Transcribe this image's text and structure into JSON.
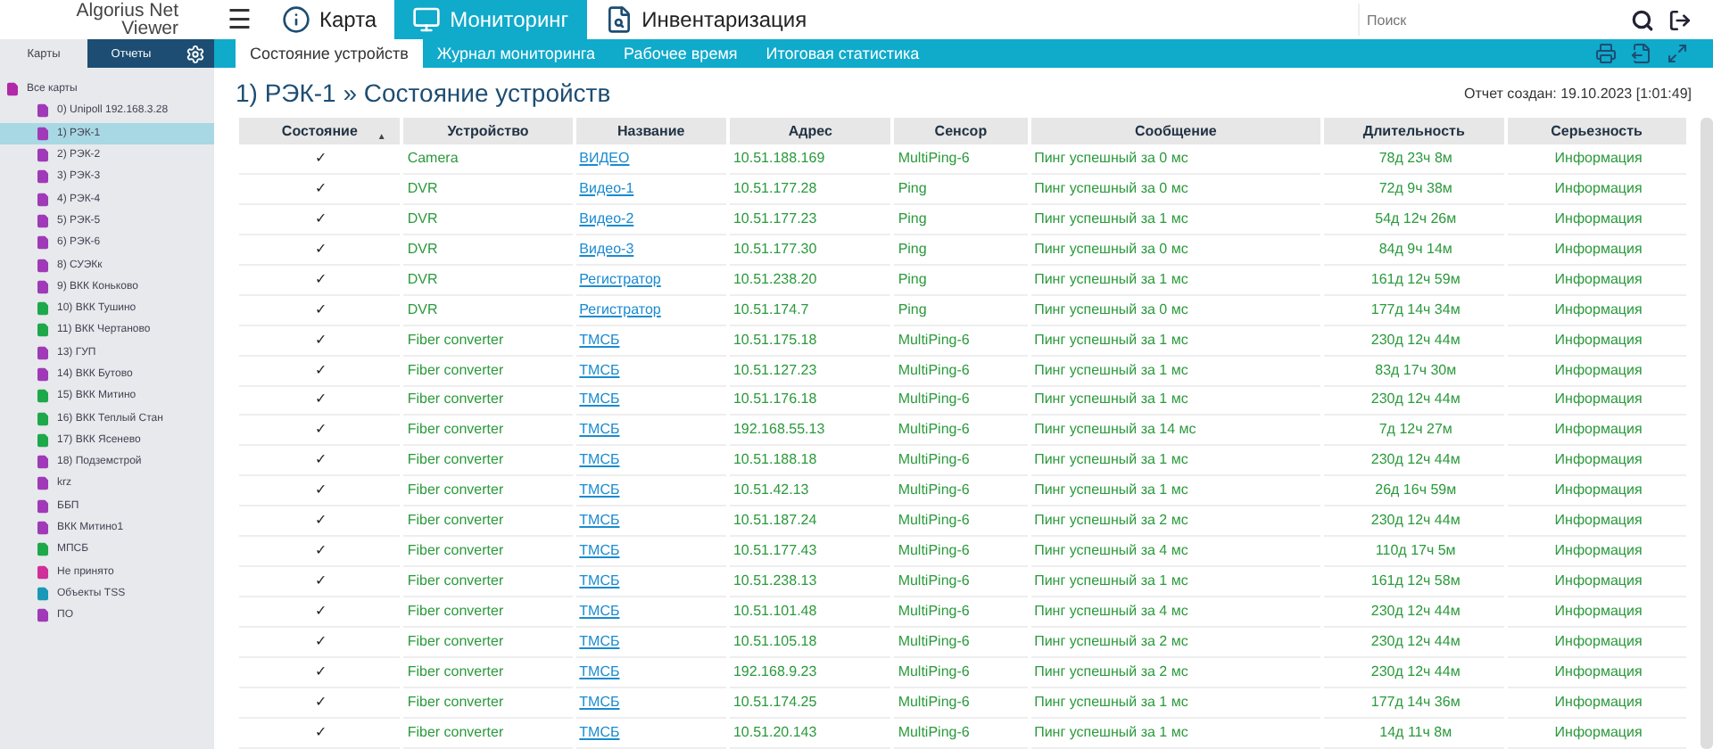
{
  "logo": {
    "line1": "Algorius Net",
    "line2": "Viewer"
  },
  "nav": {
    "menu_icon": "☰",
    "tabs": [
      {
        "label": "Карта",
        "selected": false
      },
      {
        "label": "Мониторинг",
        "selected": true
      },
      {
        "label": "Инвентаризация",
        "selected": false
      }
    ]
  },
  "search": {
    "placeholder": "Поиск"
  },
  "sidebar": {
    "tabs": [
      {
        "label": "Карты",
        "selected": true
      },
      {
        "label": "Отчеты",
        "selected": false
      }
    ],
    "root": {
      "label": "Все карты",
      "color": "#b02aa8",
      "children": [
        {
          "label": "0) Unipoll 192.168.3.28",
          "color": "#a03ab8",
          "selected": false
        },
        {
          "label": "1) РЭК-1",
          "color": "#a03ab8",
          "selected": true
        },
        {
          "label": "2) РЭК-2",
          "color": "#a03ab8",
          "selected": false
        },
        {
          "label": "3) РЭК-3",
          "color": "#a03ab8",
          "selected": false
        },
        {
          "label": "4) РЭК-4",
          "color": "#a03ab8",
          "selected": false
        },
        {
          "label": "5) РЭК-5",
          "color": "#a03ab8",
          "selected": false
        },
        {
          "label": "6) РЭК-6",
          "color": "#a03ab8",
          "selected": false
        },
        {
          "label": "8) СУЭКк",
          "color": "#a03ab8",
          "selected": false
        },
        {
          "label": "9) ВКК Коньково",
          "color": "#a03ab8",
          "selected": false
        },
        {
          "label": "10) ВКК Тушино",
          "color": "#1ea84a",
          "selected": false
        },
        {
          "label": "11) ВКК Чертаново",
          "color": "#1ea84a",
          "selected": false
        },
        {
          "label": "13) ГУП",
          "color": "#a03ab8",
          "selected": false
        },
        {
          "label": "14) ВКК Бутово",
          "color": "#a03ab8",
          "selected": false
        },
        {
          "label": "15) ВКК Митино",
          "color": "#1ea84a",
          "selected": false
        },
        {
          "label": "16) ВКК Теплый Стан",
          "color": "#1ea84a",
          "selected": false
        },
        {
          "label": "17) ВКК Ясенево",
          "color": "#1ea84a",
          "selected": false
        },
        {
          "label": "18) Подземстрой",
          "color": "#a03ab8",
          "selected": false
        },
        {
          "label": "krz",
          "color": "#a03ab8",
          "selected": false
        },
        {
          "label": "ББП",
          "color": "#a03ab8",
          "selected": false
        },
        {
          "label": "ВКК Митино1",
          "color": "#a03ab8",
          "selected": false
        },
        {
          "label": "МПСБ",
          "color": "#1ea84a",
          "selected": false
        },
        {
          "label": "Не принято",
          "color": "#d0309a",
          "selected": false
        },
        {
          "label": "Объекты TSS",
          "color": "#1a98b8",
          "selected": false
        },
        {
          "label": "ПО",
          "color": "#a03ab8",
          "selected": false
        }
      ]
    }
  },
  "subtabs": [
    {
      "label": "Состояние устройств",
      "selected": true
    },
    {
      "label": "Журнал мониторинга",
      "selected": false
    },
    {
      "label": "Рабочее время",
      "selected": false
    },
    {
      "label": "Итоговая статистика",
      "selected": false
    }
  ],
  "title": "1) РЭК-1 » Состояние устройств",
  "report_created": "Отчет создан: 19.10.2023 [1:01:49]",
  "table": {
    "columns": [
      "Состояние",
      "Устройство",
      "Название",
      "Адрес",
      "Сенсор",
      "Сообщение",
      "Длительность",
      "Серьезность"
    ],
    "sort_mark": "▲",
    "rows": [
      [
        "✓",
        "Camera",
        "ВИДЕО",
        "10.51.188.169",
        "MultiPing-6",
        "Пинг успешный за 0 мс",
        "78д 23ч 8м",
        "Информация"
      ],
      [
        "✓",
        "DVR",
        "Видео-1",
        "10.51.177.28",
        "Ping",
        "Пинг успешный за 0 мс",
        "72д 9ч 38м",
        "Информация"
      ],
      [
        "✓",
        "DVR",
        "Видео-2",
        "10.51.177.23",
        "Ping",
        "Пинг успешный за 1 мс",
        "54д 12ч 26м",
        "Информация"
      ],
      [
        "✓",
        "DVR",
        "Видео-3",
        "10.51.177.30",
        "Ping",
        "Пинг успешный за 0 мс",
        "84д 9ч 14м",
        "Информация"
      ],
      [
        "✓",
        "DVR",
        "Регистратор",
        "10.51.238.20",
        "Ping",
        "Пинг успешный за 1 мс",
        "161д 12ч 59м",
        "Информация"
      ],
      [
        "✓",
        "DVR",
        "Регистратор",
        "10.51.174.7",
        "Ping",
        "Пинг успешный за 0 мс",
        "177д 14ч 34м",
        "Информация"
      ],
      [
        "✓",
        "Fiber converter",
        "ТМСБ",
        "10.51.175.18",
        "MultiPing-6",
        "Пинг успешный за 1 мс",
        "230д 12ч 44м",
        "Информация"
      ],
      [
        "✓",
        "Fiber converter",
        "ТМСБ",
        "10.51.127.23",
        "MultiPing-6",
        "Пинг успешный за 1 мс",
        "83д 17ч 30м",
        "Информация"
      ],
      [
        "✓",
        "Fiber converter",
        "ТМСБ",
        "10.51.176.18",
        "MultiPing-6",
        "Пинг успешный за 1 мс",
        "230д 12ч 44м",
        "Информация"
      ],
      [
        "✓",
        "Fiber converter",
        "ТМСБ",
        "192.168.55.13",
        "MultiPing-6",
        "Пинг успешный за 14 мс",
        "7д 12ч 27м",
        "Информация"
      ],
      [
        "✓",
        "Fiber converter",
        "ТМСБ",
        "10.51.188.18",
        "MultiPing-6",
        "Пинг успешный за 1 мс",
        "230д 12ч 44м",
        "Информация"
      ],
      [
        "✓",
        "Fiber converter",
        "ТМСБ",
        "10.51.42.13",
        "MultiPing-6",
        "Пинг успешный за 1 мс",
        "26д 16ч 59м",
        "Информация"
      ],
      [
        "✓",
        "Fiber converter",
        "ТМСБ",
        "10.51.187.24",
        "MultiPing-6",
        "Пинг успешный за 2 мс",
        "230д 12ч 44м",
        "Информация"
      ],
      [
        "✓",
        "Fiber converter",
        "ТМСБ",
        "10.51.177.43",
        "MultiPing-6",
        "Пинг успешный за 4 мс",
        "110д 17ч 5м",
        "Информация"
      ],
      [
        "✓",
        "Fiber converter",
        "ТМСБ",
        "10.51.238.13",
        "MultiPing-6",
        "Пинг успешный за 1 мс",
        "161д 12ч 58м",
        "Информация"
      ],
      [
        "✓",
        "Fiber converter",
        "ТМСБ",
        "10.51.101.48",
        "MultiPing-6",
        "Пинг успешный за 4 мс",
        "230д 12ч 44м",
        "Информация"
      ],
      [
        "✓",
        "Fiber converter",
        "ТМСБ",
        "10.51.105.18",
        "MultiPing-6",
        "Пинг успешный за 2 мс",
        "230д 12ч 44м",
        "Информация"
      ],
      [
        "✓",
        "Fiber converter",
        "ТМСБ",
        "192.168.9.23",
        "MultiPing-6",
        "Пинг успешный за 2 мс",
        "230д 12ч 44м",
        "Информация"
      ],
      [
        "✓",
        "Fiber converter",
        "ТМСБ",
        "10.51.174.25",
        "MultiPing-6",
        "Пинг успешный за 1 мс",
        "177д 14ч 36м",
        "Информация"
      ],
      [
        "✓",
        "Fiber converter",
        "ТМСБ",
        "10.51.20.143",
        "MultiPing-6",
        "Пинг успешный за 1 мс",
        "14д 11ч 8м",
        "Информация"
      ]
    ]
  }
}
